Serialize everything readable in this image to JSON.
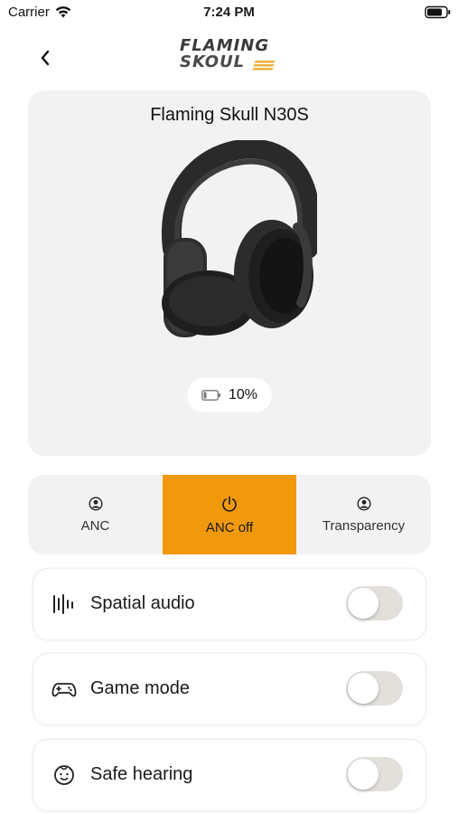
{
  "status_bar": {
    "carrier": "Carrier",
    "time": "7:24 PM"
  },
  "header": {
    "logo_line1": "FLAMING",
    "logo_line2": "SKOUL",
    "back_icon": "chevron-left-icon"
  },
  "device": {
    "name": "Flaming Skull N30S",
    "battery_text": "10%",
    "battery_level": 0.1
  },
  "modes": {
    "items": [
      {
        "label": "ANC",
        "icon": "person-icon",
        "active": false
      },
      {
        "label": "ANC off",
        "icon": "power-icon",
        "active": true
      },
      {
        "label": "Transparency",
        "icon": "person-icon",
        "active": false
      }
    ]
  },
  "settings": {
    "items": [
      {
        "label": "Spatial audio",
        "icon": "waveform-icon",
        "enabled": false
      },
      {
        "label": "Game mode",
        "icon": "gamepad-icon",
        "enabled": false
      },
      {
        "label": "Safe hearing",
        "icon": "baby-face-icon",
        "enabled": false
      }
    ]
  },
  "colors": {
    "accent": "#f0990c",
    "card_bg": "#f2f2f2",
    "toggle_off": "#e3e0dc"
  }
}
